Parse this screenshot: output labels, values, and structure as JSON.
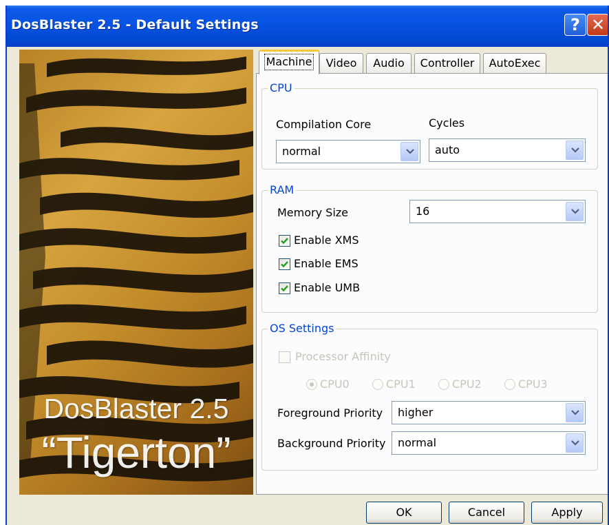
{
  "window": {
    "title": "DosBlaster 2.5 - Default Settings",
    "help_label": "?",
    "close_label": "✕"
  },
  "banner": {
    "line1": "DosBlaster 2.5",
    "line2": "“Tigerton”"
  },
  "tabs": [
    {
      "label": "Machine",
      "active": true
    },
    {
      "label": "Video",
      "active": false
    },
    {
      "label": "Audio",
      "active": false
    },
    {
      "label": "Controller",
      "active": false
    },
    {
      "label": "AutoExec",
      "active": false
    }
  ],
  "cpu": {
    "title": "CPU",
    "compilation_core_label": "Compilation Core",
    "compilation_core_value": "normal",
    "cycles_label": "Cycles",
    "cycles_value": "auto"
  },
  "ram": {
    "title": "RAM",
    "memory_size_label": "Memory Size",
    "memory_size_value": "16",
    "checks": [
      {
        "label": "Enable XMS",
        "checked": true
      },
      {
        "label": "Enable EMS",
        "checked": true
      },
      {
        "label": "Enable UMB",
        "checked": true
      }
    ]
  },
  "os": {
    "title": "OS Settings",
    "affinity_label": "Processor Affinity",
    "cpus": [
      "CPU0",
      "CPU1",
      "CPU2",
      "CPU3"
    ],
    "foreground_label": "Foreground Priority",
    "foreground_value": "higher",
    "background_label": "Background Priority",
    "background_value": "normal"
  },
  "buttons": {
    "ok": "OK",
    "cancel": "Cancel",
    "apply": "Apply"
  },
  "colors": {
    "titlebar": "#0754e4",
    "group_title": "#0046d5",
    "active_tab_accent": "#ffc83c"
  }
}
